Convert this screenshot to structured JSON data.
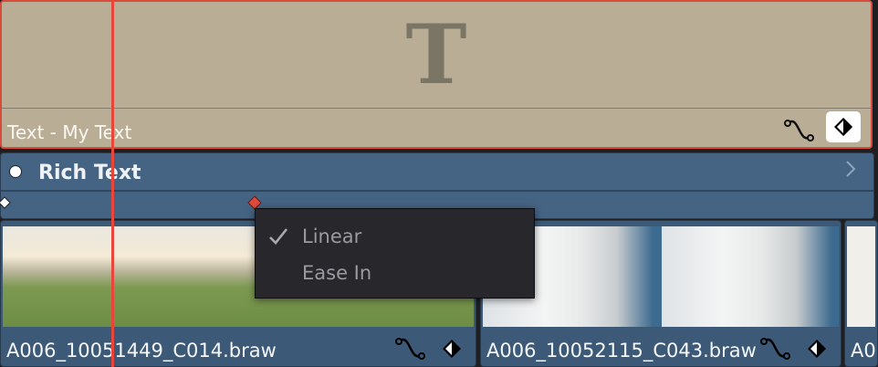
{
  "text_clip": {
    "label": "Text - My Text",
    "icon_glyph": "T"
  },
  "effect_bar": {
    "title": "Rich Text"
  },
  "clips": [
    {
      "name": "A006_10051449_C014.braw"
    },
    {
      "name": "A006_10052115_C043.braw"
    },
    {
      "name": "A00"
    }
  ],
  "context_menu": {
    "items": [
      {
        "label": "Linear",
        "checked": true
      },
      {
        "label": "Ease In",
        "checked": false
      }
    ]
  },
  "colors": {
    "selection": "#d94a3c",
    "playhead": "#e8453b",
    "keyframe_active": "#e04b3c"
  }
}
